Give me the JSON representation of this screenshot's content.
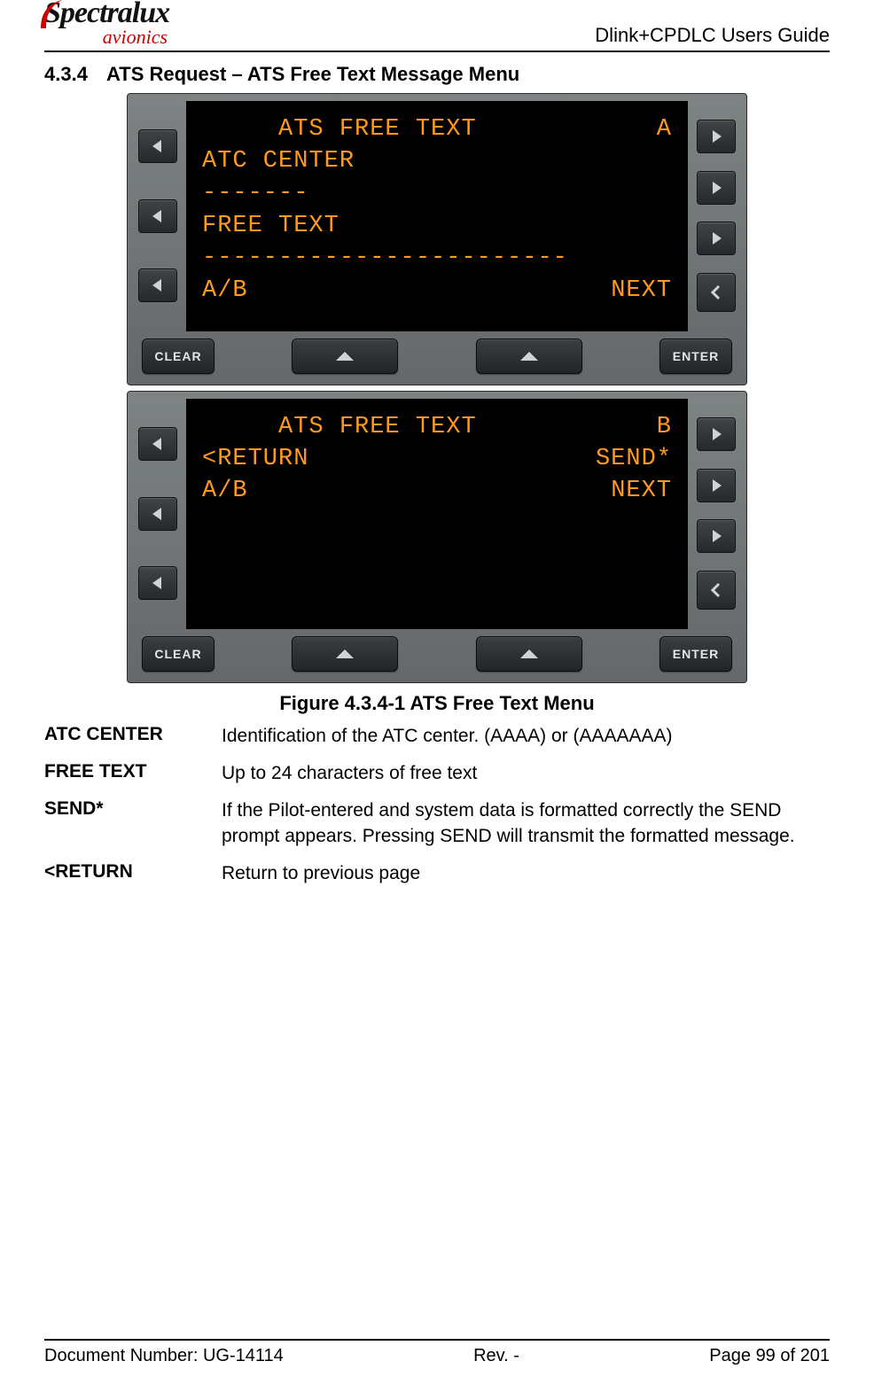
{
  "header": {
    "logo_top": "Spectralux",
    "logo_bottom": "avionics",
    "doc_title": "Dlink+CPDLC Users Guide"
  },
  "section": {
    "number": "4.3.4",
    "title": "ATS Request – ATS Free Text Message Menu"
  },
  "screens": [
    {
      "title_center": "ATS FREE TEXT",
      "title_right": "A",
      "lines": [
        {
          "left": "ATC CENTER",
          "right": ""
        },
        {
          "left": "-------",
          "right": ""
        },
        {
          "left": "FREE TEXT",
          "right": ""
        },
        {
          "left": "------------------------",
          "right": "",
          "long": true
        },
        {
          "left": "",
          "right": ""
        },
        {
          "left": "",
          "right": ""
        },
        {
          "left": "A/B",
          "right": "NEXT"
        }
      ],
      "buttons": {
        "clear": "CLEAR",
        "enter": "ENTER"
      }
    },
    {
      "title_center": "ATS FREE TEXT",
      "title_right": "B",
      "lines": [
        {
          "left": "",
          "right": ""
        },
        {
          "left": "",
          "right": ""
        },
        {
          "left": "",
          "right": ""
        },
        {
          "left": "",
          "right": ""
        },
        {
          "left": "<RETURN",
          "right": "SEND*"
        },
        {
          "left": "",
          "right": ""
        },
        {
          "left": "A/B",
          "right": "NEXT"
        }
      ],
      "buttons": {
        "clear": "CLEAR",
        "enter": "ENTER"
      }
    }
  ],
  "figure_caption": "Figure 4.3.4-1 ATS Free Text Menu",
  "definitions": [
    {
      "term": "ATC CENTER",
      "desc": "Identification of the ATC center. (AAAA) or (AAAAAAA)"
    },
    {
      "term": "FREE TEXT",
      "desc": "Up to 24 characters of free text"
    },
    {
      "term": "SEND*",
      "desc": "If the Pilot-entered and system data is formatted correctly the SEND prompt appears. Pressing SEND will transmit the formatted message."
    },
    {
      "term": "<RETURN",
      "desc": "Return to previous page"
    }
  ],
  "footer": {
    "left": "Document Number:  UG-14114",
    "center": "Rev. -",
    "right": "Page 99 of 201"
  }
}
